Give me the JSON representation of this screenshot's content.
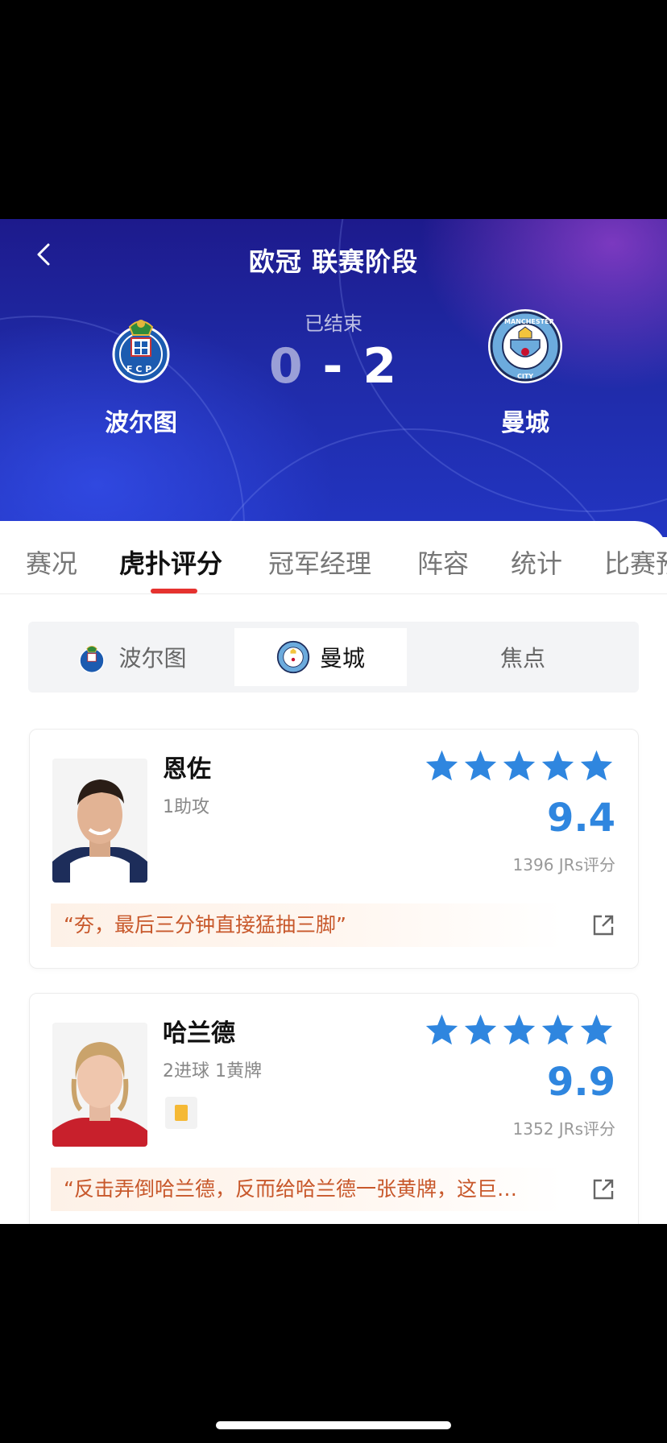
{
  "header": {
    "title": "欧冠 联赛阶段",
    "status": "已结束",
    "home_score": "0",
    "separator": "-",
    "away_score": "2",
    "home_team": "波尔图",
    "away_team": "曼城",
    "bg_color": "#1f2aa6"
  },
  "tabs": [
    {
      "label": "赛况"
    },
    {
      "label": "虎扑评分",
      "active": true
    },
    {
      "label": "冠军经理"
    },
    {
      "label": "阵容"
    },
    {
      "label": "统计"
    },
    {
      "label": "比赛预"
    }
  ],
  "segment": {
    "home_label": "波尔图",
    "away_label": "曼城",
    "focus_label": "焦点",
    "active": "曼城"
  },
  "players": [
    {
      "name": "恩佐",
      "stats": "1助攻",
      "stars": 5,
      "rating": "9.4",
      "votes": "1396 JRs评分",
      "quote": "“夯，最后三分钟直接猛抽三脚”"
    },
    {
      "name": "哈兰德",
      "stats": "2进球 1黄牌",
      "stars": 5,
      "rating": "9.9",
      "votes": "1352 JRs评分",
      "quote": "“反击弄倒哈兰德，反而给哈兰德一张黄牌，这巨…",
      "yellow_card": true
    }
  ],
  "colors": {
    "accent": "#e5322f",
    "rating": "#2f86df",
    "star": "#2f86df",
    "quote_text": "#c8582b",
    "yellow_card": "#f5b935"
  },
  "icons": [
    "back-chevron-icon",
    "porto-crest-icon",
    "man-city-crest-icon",
    "star-icon",
    "share-icon",
    "yellow-card-icon"
  ]
}
